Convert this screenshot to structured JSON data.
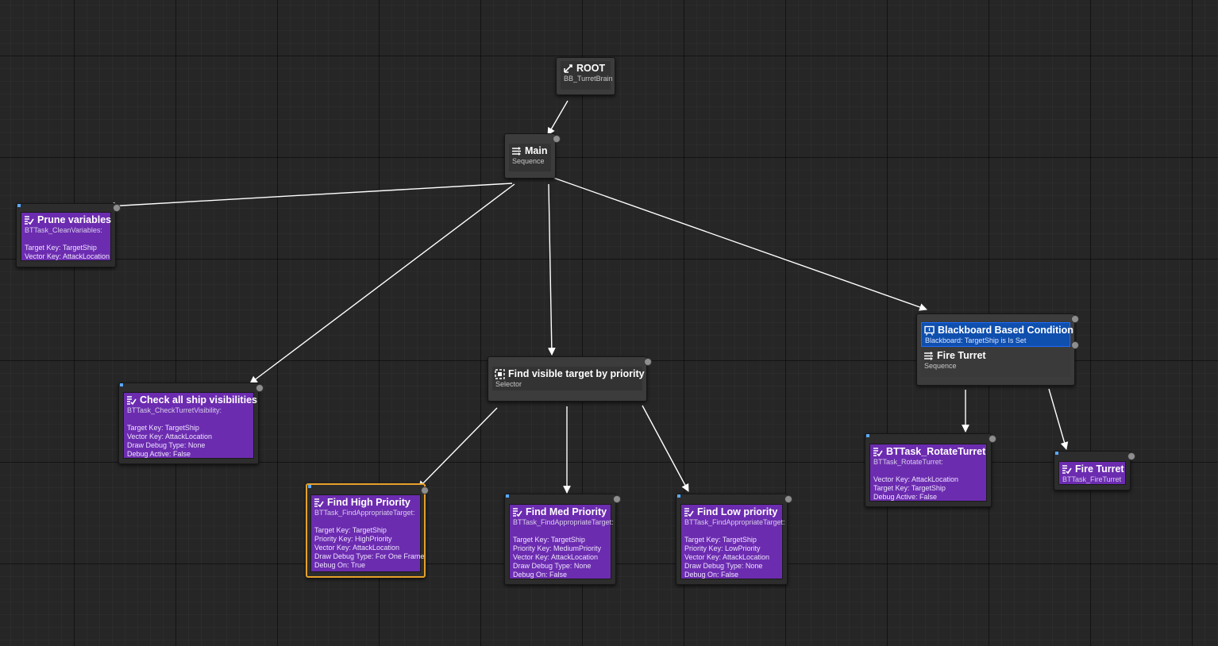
{
  "graph": {
    "root": {
      "title": "ROOT",
      "subtitle": "BB_TurretBrain",
      "icon": "root-icon"
    },
    "main": {
      "title": "Main",
      "subtitle": "Sequence",
      "icon": "sequence-icon"
    },
    "prune": {
      "title": "Prune variables",
      "subtitle": "BTTask_CleanVariables:",
      "props": "Target Key: TargetShip\nVector Key: AttackLocation",
      "icon": "task-icon"
    },
    "check_vis": {
      "title": "Check all ship visibilities",
      "subtitle": "BTTask_CheckTurretVisibility:",
      "props": "Target Key: TargetShip\nVector Key: AttackLocation\nDraw Debug Type: None\nDebug Active: False",
      "icon": "task-icon"
    },
    "find_visible": {
      "title": "Find visible target by priority",
      "subtitle": "Selector",
      "icon": "selector-icon"
    },
    "find_high": {
      "title": "Find High Priority",
      "subtitle": "BTTask_FindAppropriateTarget:",
      "props": "Target Key: TargetShip\nPriority Key: HighPriority\nVector Key: AttackLocation\nDraw Debug Type: For One Frame\nDebug On: True",
      "icon": "task-icon"
    },
    "find_med": {
      "title": "Find Med Priority",
      "subtitle": "BTTask_FindAppropriateTarget:",
      "props": "Target Key: TargetShip\nPriority Key: MediumPriority\nVector Key: AttackLocation\nDraw Debug Type: None\nDebug On: False",
      "icon": "task-icon"
    },
    "find_low": {
      "title": "Find Low priority",
      "subtitle": "BTTask_FindAppropriateTarget:",
      "props": "Target Key: TargetShip\nPriority Key: LowPriority\nVector Key: AttackLocation\nDraw Debug Type: None\nDebug On: False",
      "icon": "task-icon"
    },
    "fire_seq": {
      "decorator_title": "Blackboard Based Condition",
      "decorator_subtitle": "Blackboard: TargetShip is Is Set",
      "title": "Fire Turret",
      "subtitle": "Sequence",
      "decorator_icon": "blackboard-icon",
      "icon": "sequence-icon"
    },
    "rotate": {
      "title": "BTTask_RotateTurret",
      "subtitle": "BTTask_RotateTurret:",
      "props": "Vector Key: AttackLocation\nTarget Key: TargetShip\nDebug Active: False",
      "icon": "task-icon"
    },
    "fire_task": {
      "title": "Fire Turret",
      "subtitle": "BTTask_FireTurret",
      "icon": "task-icon"
    }
  },
  "colors": {
    "background": "#262626",
    "task": "#6c2cb0",
    "decorator": "#0f4fae",
    "selection": "#e7a02a",
    "wire": "#ffffff"
  }
}
